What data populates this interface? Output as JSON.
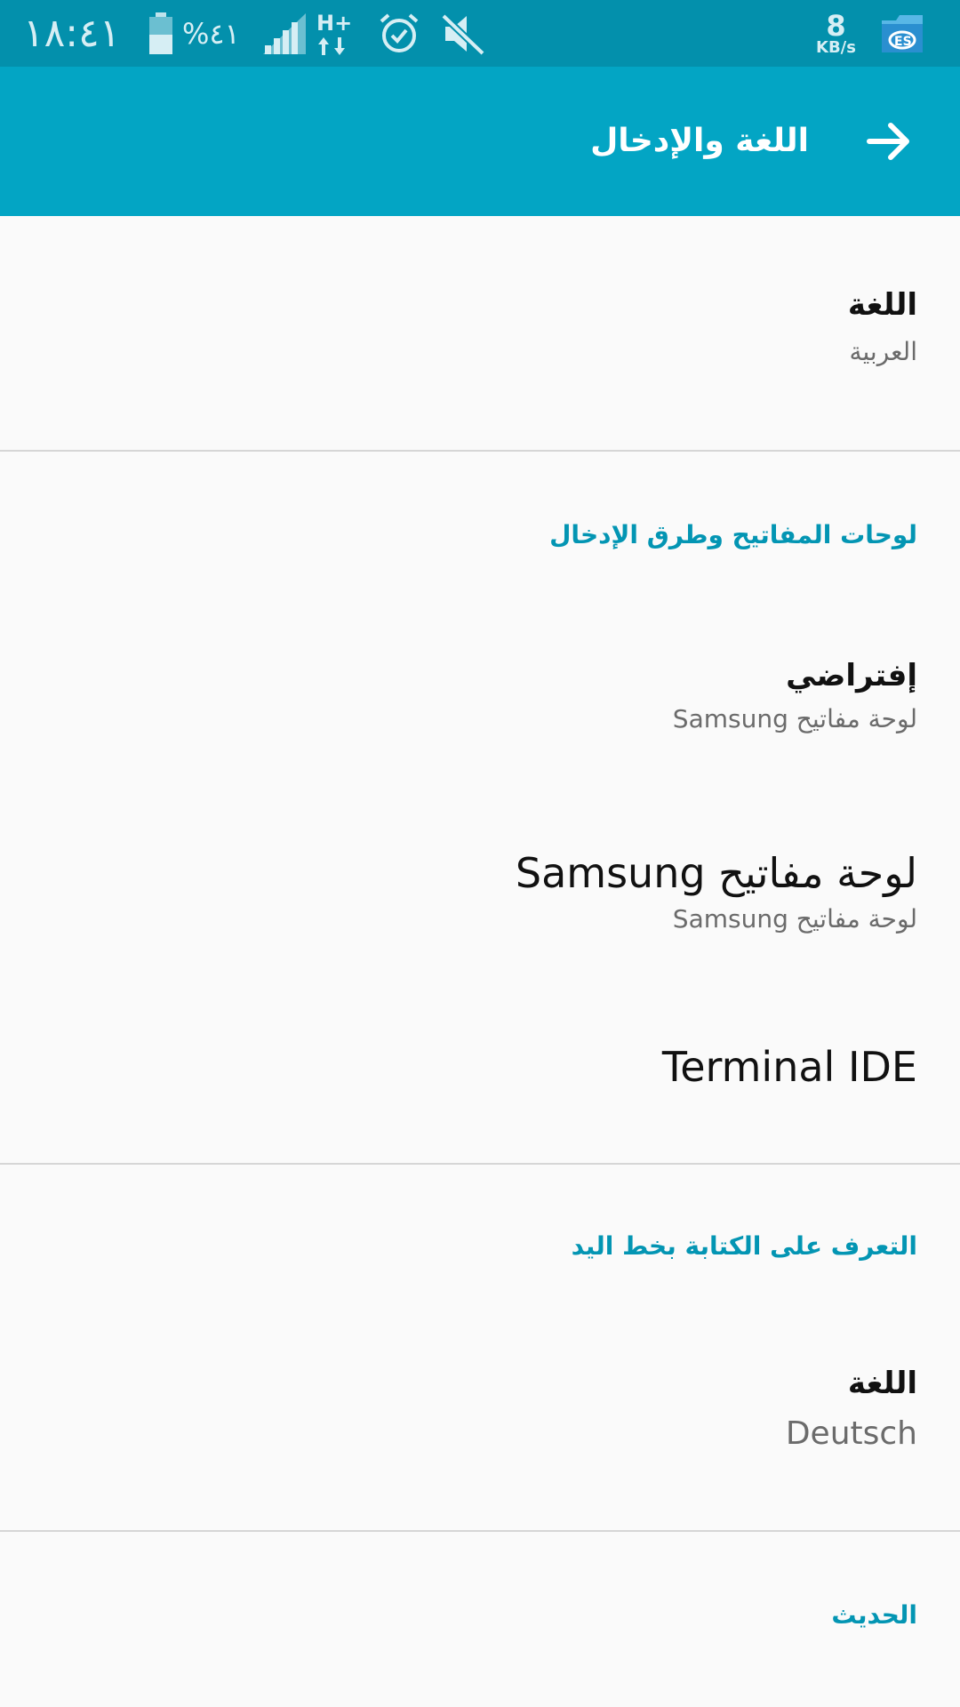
{
  "status_bar": {
    "time": "١٨:٤١",
    "battery_percent": "%٤١",
    "network_type": "H+",
    "data_speed_value": "8",
    "data_speed_unit": "KB/s",
    "icons": [
      "battery-icon",
      "signal-icon",
      "hplus-data-icon",
      "alarm-icon",
      "mute-icon",
      "es-file-explorer-icon"
    ]
  },
  "app_bar": {
    "title": "اللغة والإدخال",
    "back_icon": "arrow-right-icon",
    "color": "#03a5c4"
  },
  "sections": {
    "language": {
      "title": "اللغة",
      "summary": "العربية"
    },
    "keyboards": {
      "header": "لوحات المفاتيح وطرق الإدخال",
      "items": [
        {
          "title": "إفتراضي",
          "summary": "لوحة مفاتيح Samsung"
        },
        {
          "title": "لوحة مفاتيح Samsung",
          "summary": "لوحة مفاتيح Samsung"
        },
        {
          "title": "Terminal IDE"
        }
      ]
    },
    "handwriting": {
      "header": "التعرف على الكتابة بخط اليد",
      "language_title": "اللغة",
      "language_summary": "Deutsch"
    },
    "speech": {
      "header": "الحديث"
    }
  },
  "colors": {
    "accent": "#0395b3",
    "status_bar": "#0390ac",
    "background": "#fafafa"
  }
}
